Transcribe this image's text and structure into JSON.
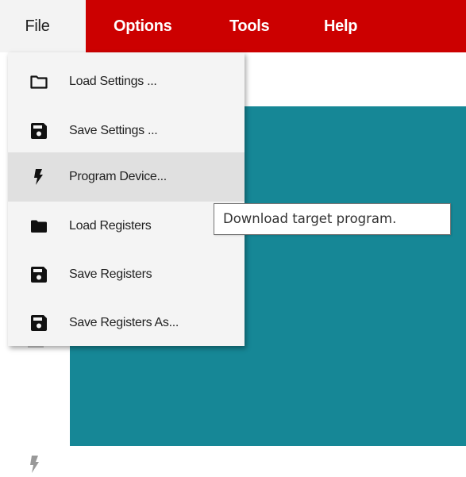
{
  "menubar": {
    "file": "File",
    "options": "Options",
    "tools": "Tools",
    "help": "Help",
    "accent_color": "#cc0000"
  },
  "file_menu": {
    "items": [
      {
        "label": "Load Settings ...",
        "icon": "folder-outline-icon"
      },
      {
        "label": "Save Settings ...",
        "icon": "floppy-disk-icon"
      },
      {
        "label": "Program Device...",
        "icon": "lightning-bolt-icon",
        "hovered": true
      },
      {
        "label": "Load Registers",
        "icon": "folder-filled-icon"
      },
      {
        "label": "Save Registers",
        "icon": "floppy-disk-icon"
      },
      {
        "label": "Save Registers As...",
        "icon": "floppy-disk-icon"
      }
    ]
  },
  "tooltip": {
    "text": "Download target program."
  },
  "content": {
    "teal_color": "#168796"
  }
}
